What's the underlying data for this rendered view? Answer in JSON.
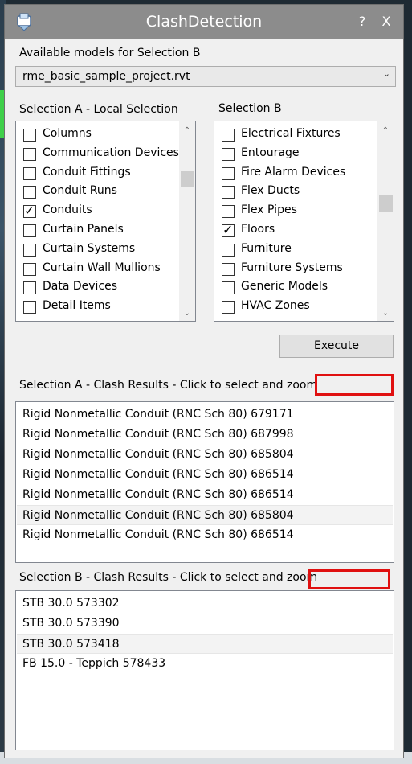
{
  "window": {
    "title": "ClashDetection",
    "help_label": "?",
    "close_label": "X",
    "app_icon": "window-app-icon"
  },
  "models": {
    "label": "Available models for Selection B",
    "selected": "rme_basic_sample_project.rvt"
  },
  "selection_a": {
    "label": "Selection A - Local Selection",
    "items": [
      {
        "label": "Columns",
        "checked": false
      },
      {
        "label": "Communication Devices",
        "checked": false
      },
      {
        "label": "Conduit Fittings",
        "checked": false
      },
      {
        "label": "Conduit Runs",
        "checked": false
      },
      {
        "label": "Conduits",
        "checked": true
      },
      {
        "label": "Curtain Panels",
        "checked": false
      },
      {
        "label": "Curtain Systems",
        "checked": false
      },
      {
        "label": "Curtain Wall Mullions",
        "checked": false
      },
      {
        "label": "Data Devices",
        "checked": false
      },
      {
        "label": "Detail Items",
        "checked": false
      }
    ],
    "scroll_position": 0.22
  },
  "selection_b": {
    "label": "Selection B",
    "items": [
      {
        "label": "Electrical Fixtures",
        "checked": false
      },
      {
        "label": "Entourage",
        "checked": false
      },
      {
        "label": "Fire Alarm Devices",
        "checked": false
      },
      {
        "label": "Flex Ducts",
        "checked": false
      },
      {
        "label": "Flex Pipes",
        "checked": false
      },
      {
        "label": "Floors",
        "checked": true
      },
      {
        "label": "Furniture",
        "checked": false
      },
      {
        "label": "Furniture Systems",
        "checked": false
      },
      {
        "label": "Generic Models",
        "checked": false
      },
      {
        "label": "HVAC Zones",
        "checked": false
      }
    ],
    "scroll_position": 0.38
  },
  "execute_label": "Execute",
  "results_a": {
    "label": "Selection A  - Clash Results - Click to select and zoom",
    "items": [
      "Rigid Nonmetallic Conduit (RNC Sch 80) 679171",
      "Rigid Nonmetallic Conduit (RNC Sch 80) 687998",
      "Rigid Nonmetallic Conduit (RNC Sch 80) 685804",
      "Rigid Nonmetallic Conduit (RNC Sch 80) 686514",
      "Rigid Nonmetallic Conduit (RNC Sch 80) 686514",
      "Rigid Nonmetallic Conduit (RNC Sch 80) 685804",
      "Rigid Nonmetallic Conduit (RNC Sch 80) 686514"
    ],
    "selected_index": 5
  },
  "results_b": {
    "label": "Selection B - Clash Results - Click to select and zoom",
    "items": [
      "STB 30.0 573302",
      "STB 30.0 573390",
      "STB 30.0 573418",
      "FB 15.0 - Teppich 578433"
    ],
    "selected_index": 2
  },
  "colors": {
    "titlebar": "#8c8c8c",
    "highlight_box": "#e01010",
    "window_bg": "#f0f0f0"
  }
}
